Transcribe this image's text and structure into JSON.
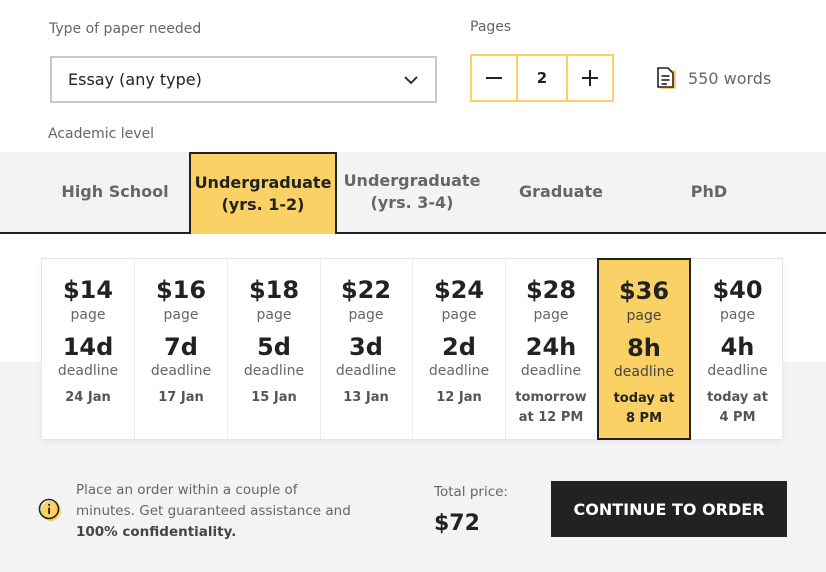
{
  "form": {
    "type_label": "Type of paper needed",
    "type_value": "Essay (any type)",
    "pages_label": "Pages",
    "pages_value": "2",
    "words_text": "550 words",
    "level_label": "Academic level"
  },
  "levels": [
    {
      "line1": "High School",
      "line2": ""
    },
    {
      "line1": "Undergraduate",
      "line2": "(yrs. 1-2)"
    },
    {
      "line1": "Undergraduate",
      "line2": "(yrs. 3-4)"
    },
    {
      "line1": "Graduate",
      "line2": ""
    },
    {
      "line1": "PhD",
      "line2": ""
    }
  ],
  "deadlines": [
    {
      "price": "$14",
      "per": "page",
      "time": "14d",
      "dl": "deadline",
      "date1": "24 Jan",
      "date2": ""
    },
    {
      "price": "$16",
      "per": "page",
      "time": "7d",
      "dl": "deadline",
      "date1": "17 Jan",
      "date2": ""
    },
    {
      "price": "$18",
      "per": "page",
      "time": "5d",
      "dl": "deadline",
      "date1": "15 Jan",
      "date2": ""
    },
    {
      "price": "$22",
      "per": "page",
      "time": "3d",
      "dl": "deadline",
      "date1": "13 Jan",
      "date2": ""
    },
    {
      "price": "$24",
      "per": "page",
      "time": "2d",
      "dl": "deadline",
      "date1": "12 Jan",
      "date2": ""
    },
    {
      "price": "$28",
      "per": "page",
      "time": "24h",
      "dl": "deadline",
      "date1": "tomorrow",
      "date2": "at 12 PM"
    },
    {
      "price": "$36",
      "per": "page",
      "time": "8h",
      "dl": "deadline",
      "date1": "today at",
      "date2": "8 PM"
    },
    {
      "price": "$40",
      "per": "page",
      "time": "4h",
      "dl": "deadline",
      "date1": "today at",
      "date2": "4 PM"
    }
  ],
  "notice": {
    "line1": "Place an order within a couple of",
    "line2": "minutes. Get guaranteed assistance and",
    "bold": "100% confidentiality."
  },
  "total": {
    "label": "Total price:",
    "value": "$72"
  },
  "cta_label": "CONTINUE TO ORDER",
  "colors": {
    "accent": "#fad165",
    "dark": "#222222",
    "band": "#f3f3f3"
  },
  "icons": {
    "dropdown": "chevron-down-icon",
    "minus": "minus-icon",
    "plus": "plus-icon",
    "words": "document-icon",
    "info": "info-icon"
  }
}
